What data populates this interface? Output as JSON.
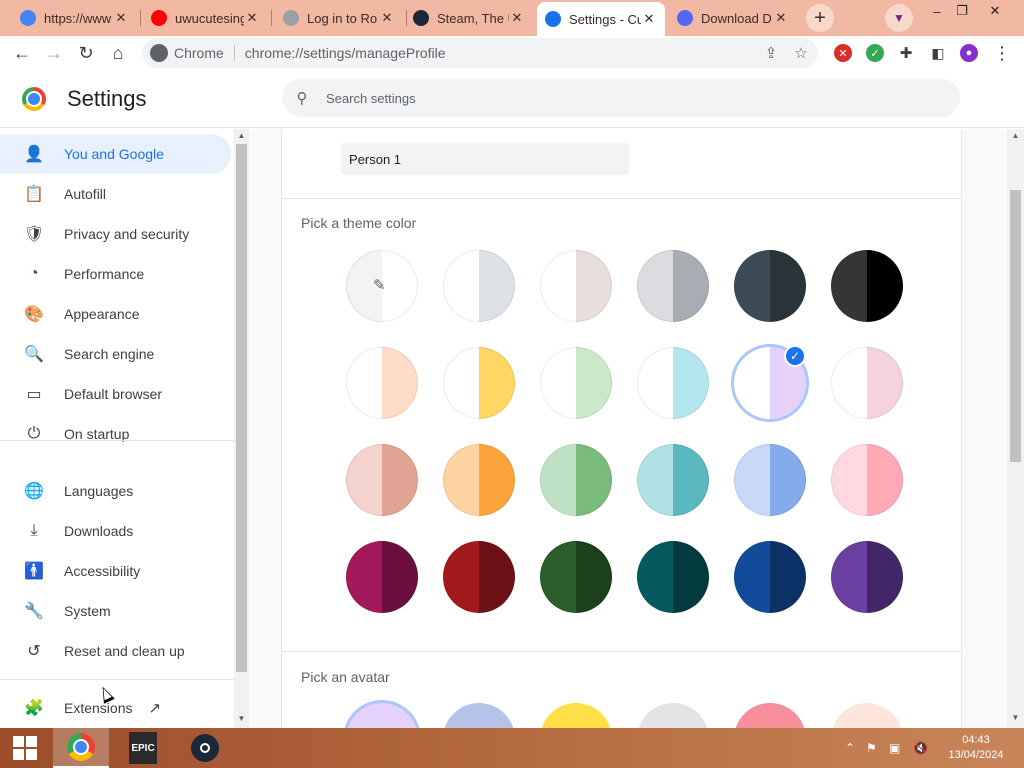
{
  "tabs": [
    {
      "title": "https://www",
      "favicon": "google-g-icon",
      "color": "#4285f4"
    },
    {
      "title": "uwucutesing",
      "favicon": "youtube-icon",
      "color": "#ff0000"
    },
    {
      "title": "Log in to Ro",
      "favicon": "roblox-icon",
      "color": "#9aa0a6"
    },
    {
      "title": "Steam, The U",
      "favicon": "steam-icon",
      "color": "#1b2838"
    },
    {
      "title": "Settings - Cu",
      "favicon": "settings-gear-icon",
      "color": "#1a73e8"
    },
    {
      "title": "Download D",
      "favicon": "discord-icon",
      "color": "#5865f2"
    }
  ],
  "window": {
    "minimize": "–",
    "maximize": "❐",
    "close": "✕"
  },
  "omnibox": {
    "site": "Chrome",
    "url": "chrome://settings/manageProfile"
  },
  "header": {
    "title": "Settings",
    "search_placeholder": "Search settings"
  },
  "sidebar": {
    "items": [
      {
        "label": "You and Google",
        "icon": "person-icon",
        "glyph": "👤"
      },
      {
        "label": "Autofill",
        "icon": "clipboard-icon",
        "glyph": "📋"
      },
      {
        "label": "Privacy and security",
        "icon": "shield-icon",
        "glyph": "🛡"
      },
      {
        "label": "Performance",
        "icon": "speedometer-icon",
        "glyph": "◔"
      },
      {
        "label": "Appearance",
        "icon": "palette-icon",
        "glyph": "🎨"
      },
      {
        "label": "Search engine",
        "icon": "search-icon",
        "glyph": "🔍"
      },
      {
        "label": "Default browser",
        "icon": "browser-window-icon",
        "glyph": "▭"
      },
      {
        "label": "On startup",
        "icon": "power-icon",
        "glyph": "⏻"
      },
      {
        "label": "Languages",
        "icon": "globe-icon",
        "glyph": "🌐"
      },
      {
        "label": "Downloads",
        "icon": "download-icon",
        "glyph": "⤓"
      },
      {
        "label": "Accessibility",
        "icon": "accessibility-icon",
        "glyph": "🚹"
      },
      {
        "label": "System",
        "icon": "wrench-icon",
        "glyph": "🔧"
      },
      {
        "label": "Reset and clean up",
        "icon": "history-icon",
        "glyph": "↺"
      },
      {
        "label": "Extensions",
        "icon": "puzzle-icon",
        "glyph": "🧩"
      }
    ]
  },
  "profile": {
    "name": "Person 1"
  },
  "theme": {
    "label": "Pick a theme color",
    "selected_index": 10,
    "colors": [
      [
        "#f1f3f4",
        "#ffffff"
      ],
      [
        "#ffffff",
        "#dee1e6"
      ],
      [
        "#ffffff",
        "#e8dedc"
      ],
      [
        "#dadce0",
        "#a8acb3"
      ],
      [
        "#3c4c55",
        "#2a3337"
      ],
      [
        "#353535",
        "#000000"
      ],
      [
        "#ffffff",
        "#fddcc8"
      ],
      [
        "#ffffff",
        "#fdd663"
      ],
      [
        "#ffffff",
        "#cbe8c8"
      ],
      [
        "#ffffff",
        "#b4e6ef"
      ],
      [
        "#ffffff",
        "#e6d1fa"
      ],
      [
        "#ffffff",
        "#f6d2e0"
      ],
      [
        "#f3d3cc",
        "#e0a594"
      ],
      [
        "#fdd3a3",
        "#fba43c"
      ],
      [
        "#c0e2c4",
        "#7aba7c"
      ],
      [
        "#b0e0e6",
        "#5ab8bf"
      ],
      [
        "#c7d9f7",
        "#85abea"
      ],
      [
        "#ffd9e0",
        "#ffa9b6"
      ],
      [
        "#a3185a",
        "#6c0f3c"
      ],
      [
        "#a31a1c",
        "#6d1214"
      ],
      [
        "#2a5e2a",
        "#1b401b"
      ],
      [
        "#055a5f",
        "#033a3d"
      ],
      [
        "#124b9a",
        "#0b3166"
      ],
      [
        "#6a3fa0",
        "#432667"
      ]
    ]
  },
  "avatar": {
    "label": "Pick an avatar",
    "colors": [
      "#e6d1fa",
      "#b6c3e8",
      "#fde047",
      "#e3e3e3",
      "#f78e9a",
      "#fde5dc"
    ]
  },
  "taskbar": {
    "apps": [
      {
        "name": "chrome-taskbar-icon",
        "active": true
      },
      {
        "name": "epic-games-taskbar-icon",
        "label": "EPIC"
      },
      {
        "name": "steam-taskbar-icon"
      }
    ],
    "time": "04:43",
    "date": "13/04/2024"
  }
}
